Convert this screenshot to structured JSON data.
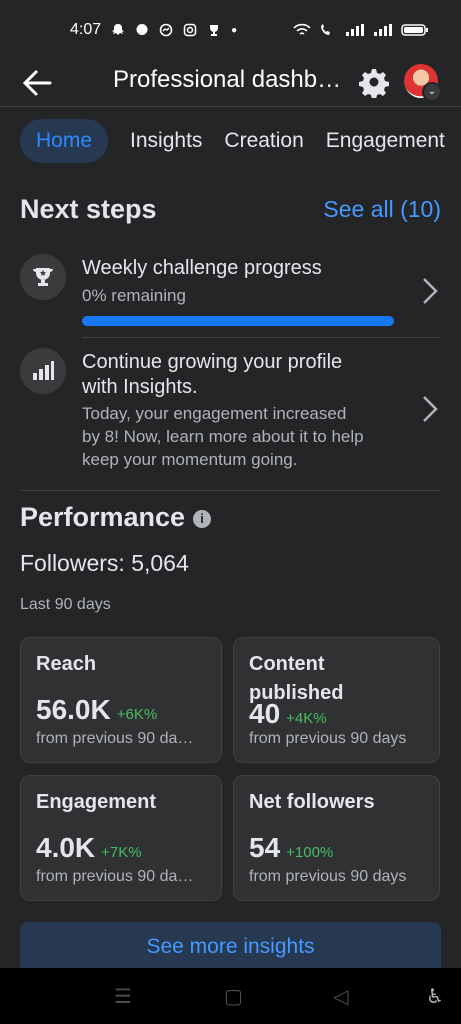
{
  "status": {
    "time": "4:07"
  },
  "header": {
    "title": "Professional dashb…"
  },
  "tabs": [
    "Home",
    "Insights",
    "Creation",
    "Engagement"
  ],
  "next_steps": {
    "title": "Next steps",
    "see_all": "See all (10)",
    "items": [
      {
        "title": "Weekly challenge progress",
        "subtitle": "0% remaining",
        "progress": 1.0
      },
      {
        "title_line1": "Continue growing your profile",
        "title_line2": "with Insights.",
        "desc_line1": "Today, your engagement increased",
        "desc_line2": "by 8! Now, learn more about it to help",
        "desc_line3": "keep your momentum going."
      }
    ]
  },
  "performance": {
    "title": "Performance",
    "followers": "Followers: 5,064",
    "range": "Last 90 days",
    "cards": [
      {
        "title": "Reach",
        "value": "56.0K",
        "delta": "+6K%",
        "note": "from previous 90 da…"
      },
      {
        "title_line1": "Content",
        "title_line2": "published",
        "value": "40",
        "delta": "+4K%",
        "note": "from previous 90 days"
      },
      {
        "title": "Engagement",
        "value": "4.0K",
        "delta": "+7K%",
        "note": "from previous 90 da…"
      },
      {
        "title": "Net followers",
        "value": "54",
        "delta": "+100%",
        "note": "from previous 90 days"
      }
    ],
    "button": "See more insights"
  },
  "colors": {
    "accent": "#1877f2",
    "link": "#4599ff",
    "positive": "#45bd62",
    "background": "#242526"
  }
}
